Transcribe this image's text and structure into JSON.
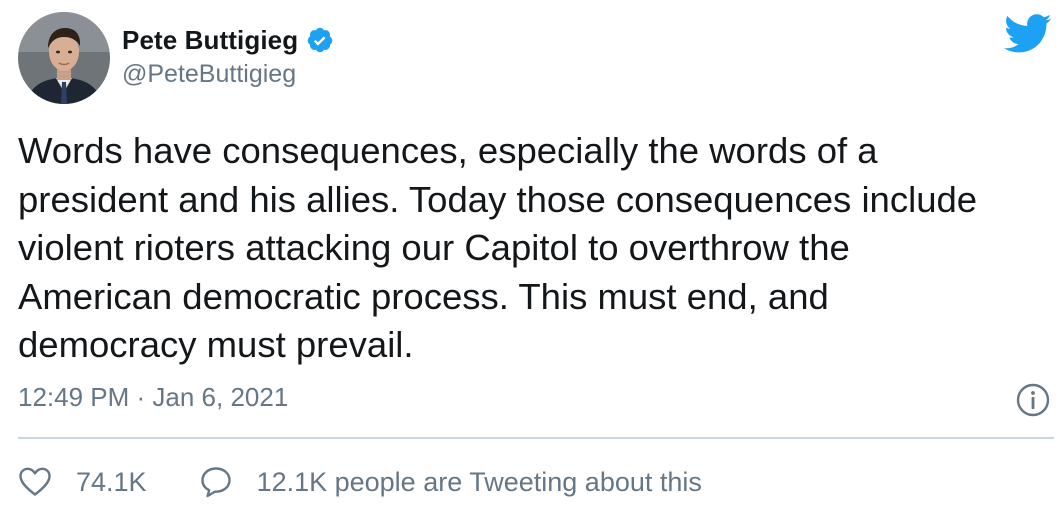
{
  "author": {
    "display_name": "Pete Buttigieg",
    "handle": "@PeteButtigieg",
    "verified": true,
    "avatar": "profile-photo"
  },
  "brand": {
    "icon": "twitter-bird-icon",
    "color": "#1da1f2"
  },
  "tweet": {
    "text": "Words have consequences, especially the words of a\npresident and his allies. Today those consequences include\nviolent rioters attacking our Capitol to overthrow the\nAmerican democratic process. This must end, and\ndemocracy must prevail.",
    "timestamp": "12:49 PM · Jan 6, 2021"
  },
  "engagement": {
    "likes": "74.1K",
    "conversation": "12.1K people are Tweeting about this"
  },
  "icons": {
    "info": "info-icon",
    "like": "heart-icon",
    "reply": "speech-bubble-icon"
  },
  "colors": {
    "text": "#14171a",
    "secondary": "#657786",
    "divider": "#ccd6dd",
    "accent": "#1da1f2"
  }
}
